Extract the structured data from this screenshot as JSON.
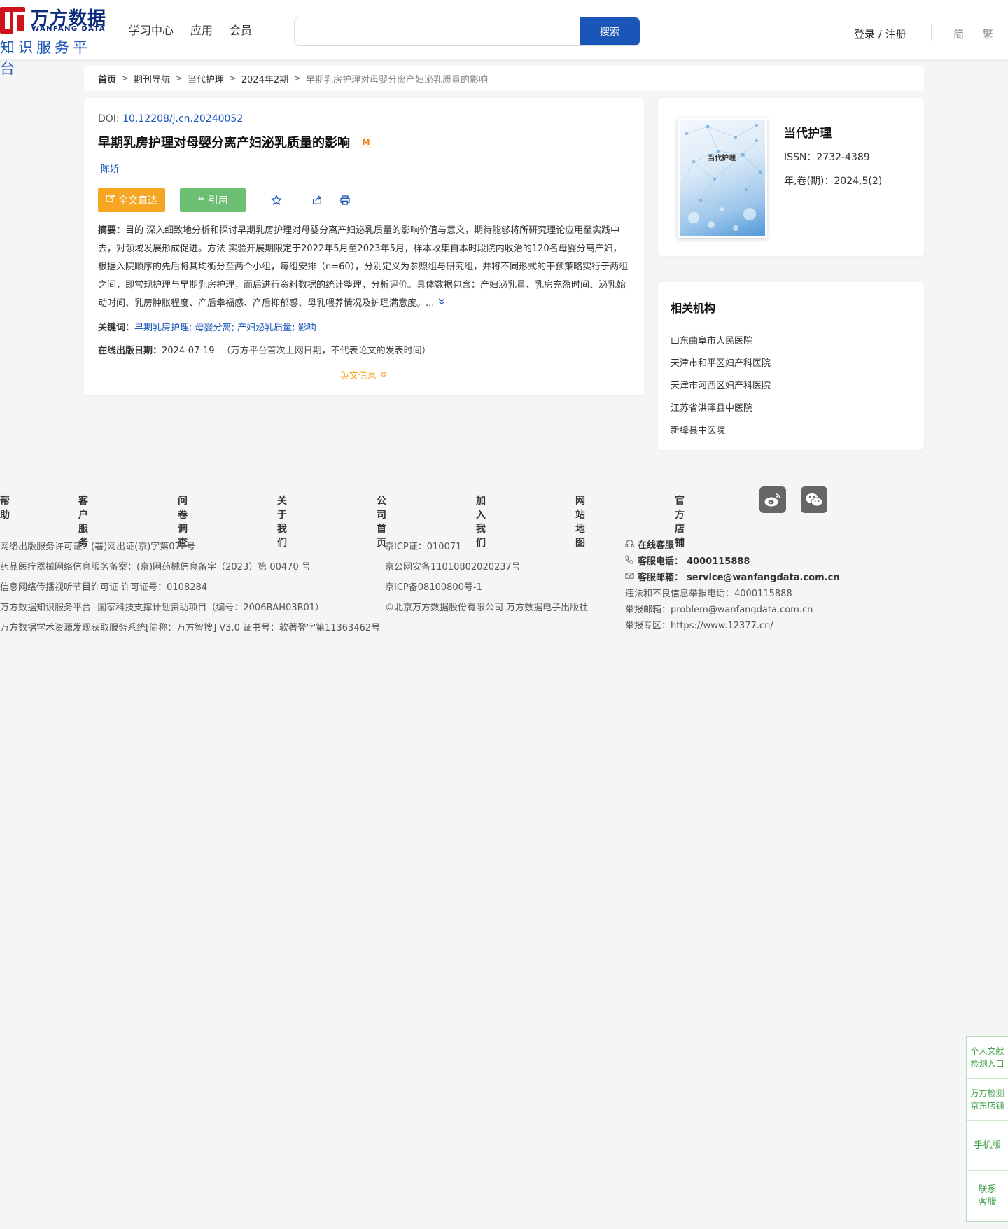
{
  "header": {
    "logo": {
      "cn": "万方数据",
      "en": "WANFANG DATA",
      "sub": "知识服务平台"
    },
    "nav": [
      "学习中心",
      "应用",
      "会员"
    ],
    "search": {
      "value": "",
      "placeholder": "",
      "button": "搜索"
    },
    "login": "登录 / 注册",
    "lang_simplified": "简",
    "lang_traditional": "繁"
  },
  "breadcrumb": [
    "首页",
    "期刊导航",
    "当代护理",
    "2024年2期"
  ],
  "breadcrumb_current": "早期乳房护理对母婴分离产妇泌乳质量的影响",
  "breadcrumb_sep": ">",
  "article": {
    "doi_label": "DOI: ",
    "doi": "10.12208/j.cn.20240052",
    "title": "早期乳房护理对母婴分离产妇泌乳质量的影响",
    "badge": "M",
    "author": "陈娇",
    "fulltext_button": "全文直达",
    "cite_button": "引用",
    "abstract_label": "摘要：",
    "abstract": "目的 深入细致地分析和探讨早期乳房护理对母婴分离产妇泌乳质量的影响价值与意义，期待能够将所研究理论应用至实践中去，对领域发展形成促进。方法 实验开展期限定于2022年5月至2023年5月，样本收集自本时段院内收治的120名母婴分离产妇，根据入院顺序的先后将其均衡分至两个小组，每组安排（n=60），分别定义为参照组与研究组，并将不同形式的干预策略实行于两组之间，即常规护理与早期乳房护理，而后进行资料数据的统计整理，分析评价。具体数据包含：产妇泌乳量、乳房充盈时间、泌乳始动时间、乳房肿胀程度、产后幸福感、产后抑郁感、母乳喂养情况及护理满意度。...",
    "keywords_label": "关键词：",
    "keywords": [
      "早期乳房护理",
      "母婴分离",
      "产妇泌乳质量",
      "影响"
    ],
    "pubdate_label": "在线出版日期：",
    "pubdate": "2024-07-19",
    "pubdate_note": "（万方平台首次上网日期，不代表论文的发表时间）",
    "english_info": "英文信息"
  },
  "journal": {
    "cover_title": "当代护理",
    "name": "当代护理",
    "issn": "ISSN：2732-4389",
    "volume": "年,卷(期)：2024,5(2)"
  },
  "institutions": {
    "title": "相关机构",
    "items": [
      "山东曲阜市人民医院",
      "天津市和平区妇产科医院",
      "天津市河西区妇产科医院",
      "江苏省洪泽县中医院",
      "新绛县中医院"
    ]
  },
  "footer": {
    "links": [
      "帮助",
      "客户服务",
      "问卷调查",
      "关于我们",
      "公司首页",
      "加入我们",
      "网站地图",
      "官方店铺"
    ],
    "col1": [
      "网络出版服务许可证：(署)网出证(京)字第072号",
      "药品医疗器械网络信息服务备案：(京)网药械信息备字（2023）第 00470 号",
      "信息网络传播视听节目许可证 许可证号：0108284",
      "万方数据知识服务平台--国家科技支撑计划资助项目（编号：2006BAH03B01）",
      "万方数据学术资源发现获取服务系统[简称：万方智搜] V3.0 证书号：软著登字第11363462号"
    ],
    "col2": [
      "京ICP证：010071",
      "京公网安备11010802020237号",
      "京ICP备08100800号-1",
      "©北京万方数据股份有限公司 万方数据电子出版社"
    ],
    "online_service": "在线客服",
    "phone_label": "客服电话：",
    "phone": "4000115888",
    "email_label": "客服邮箱：",
    "email": "service@wanfangdata.com.cn",
    "report_phone": "违法和不良信息举报电话：4000115888",
    "report_email": "举报邮箱：problem@wanfangdata.com.cn",
    "report_zone": "举报专区：https://www.12377.cn/"
  },
  "float_bar": {
    "item1": [
      "个人文献",
      "检测入口"
    ],
    "item2": [
      "万方检测",
      "京东店铺"
    ],
    "item3": "手机版",
    "item4": [
      "联系",
      "客服"
    ]
  },
  "colors": {
    "primary": "#1a56b7",
    "orange": "#f5a623",
    "green": "#6cbf72",
    "logo_red": "#d0121b"
  }
}
